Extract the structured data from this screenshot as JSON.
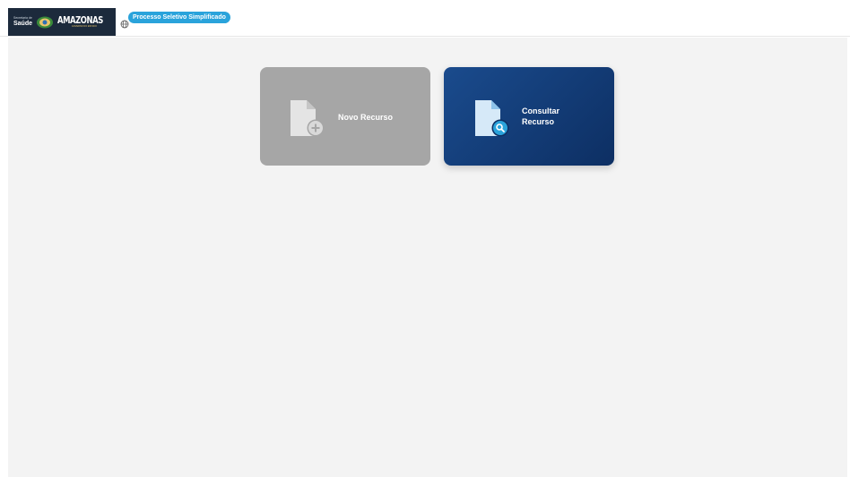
{
  "header": {
    "logo": {
      "secretaria_small": "Secretaria de",
      "secretaria_big": "Saúde",
      "state_name": "AMAZONAS",
      "state_tagline": "GOVERNO DO ESTADO"
    },
    "badge_label": "Processo Seletivo Simplificado"
  },
  "cards": {
    "novo": {
      "label": "Novo Recurso"
    },
    "consultar": {
      "label": "Consultar Recurso"
    }
  },
  "colors": {
    "badge": "#2aa3db",
    "card_disabled": "#a6a6a6",
    "card_primary": "#1a4b8d",
    "background": "#f3f3f3"
  }
}
